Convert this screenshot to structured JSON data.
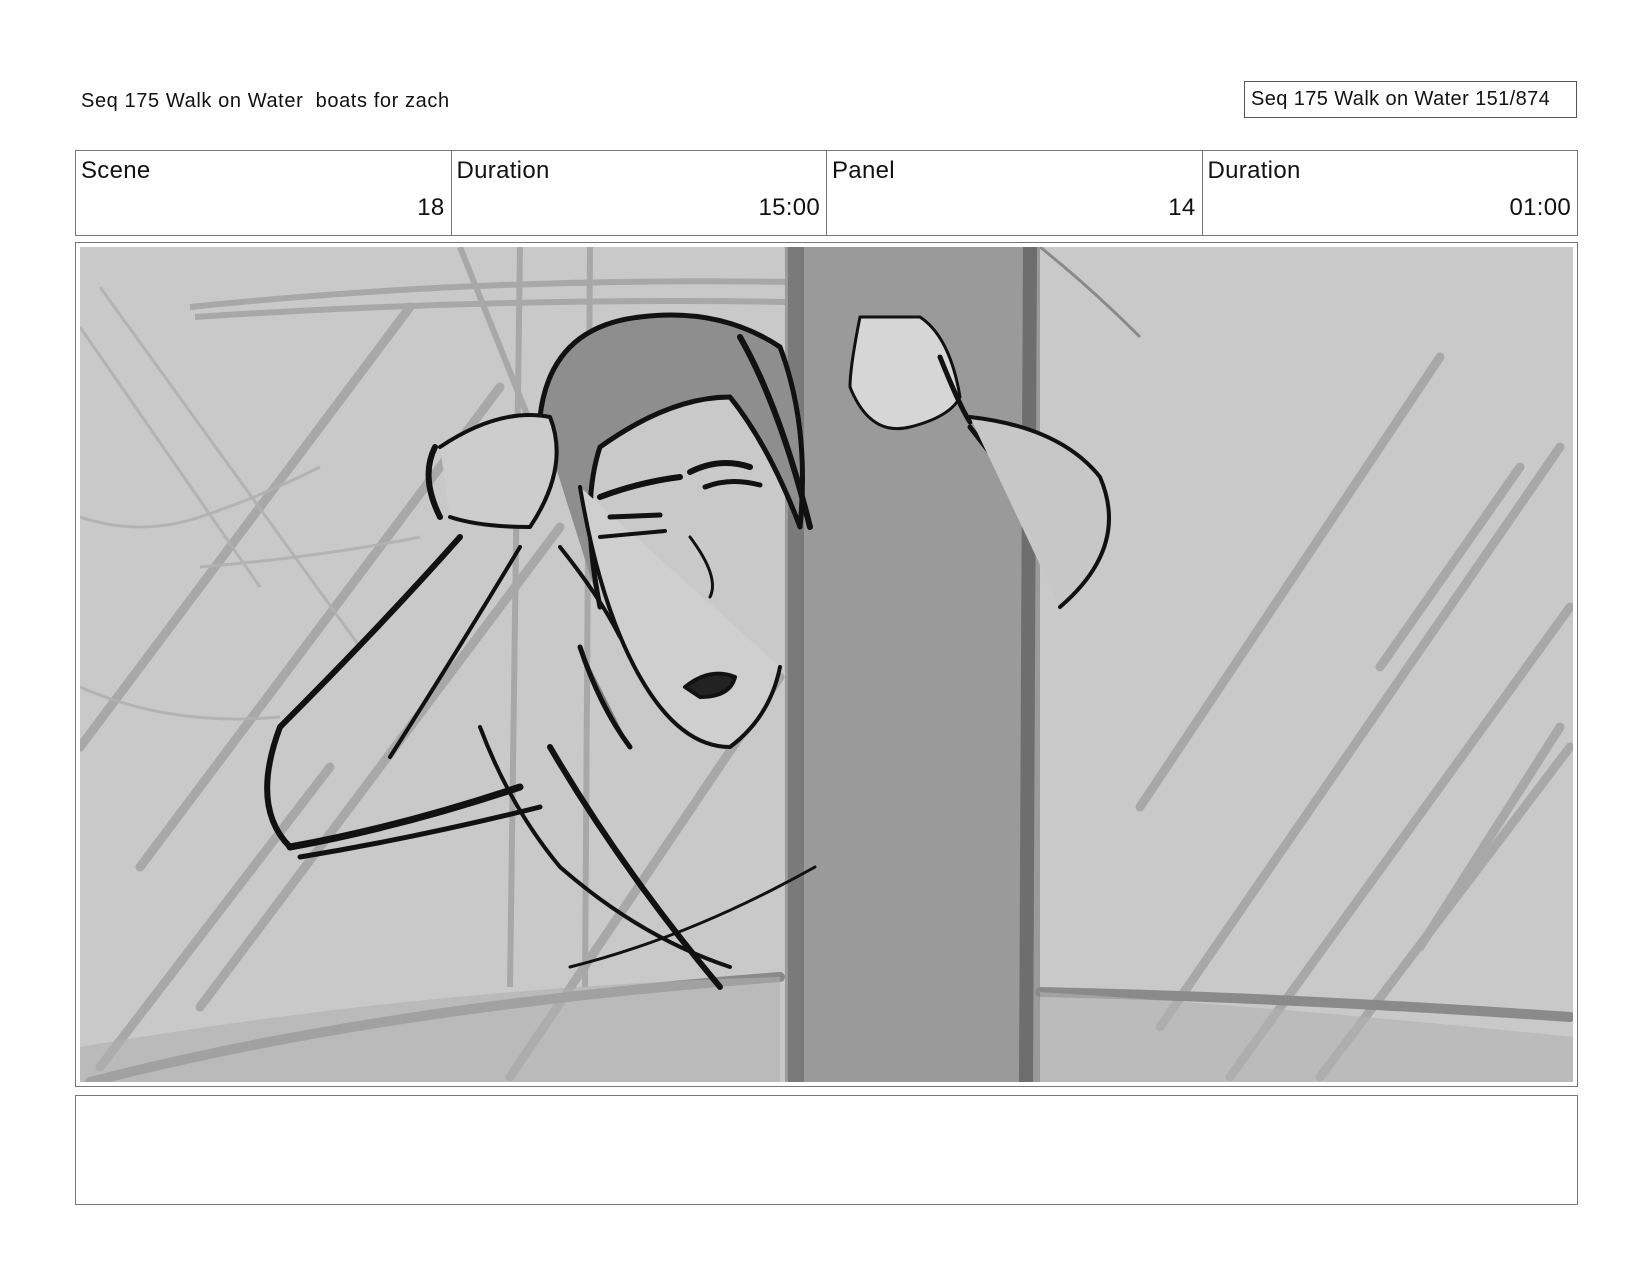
{
  "header": {
    "left_title": "Seq 175 Walk on Water  boats for zach",
    "right_title": "Seq 175 Walk on Water 151/874"
  },
  "info": [
    {
      "label": "Scene",
      "value": "18"
    },
    {
      "label": "Duration",
      "value": "15:00"
    },
    {
      "label": "Panel",
      "value": "14"
    },
    {
      "label": "Duration",
      "value": "01:00"
    }
  ],
  "panel": {
    "image_icon": "storyboard-sketch",
    "background_color": "#c9c9c9",
    "mast_color": "#9a9a9a"
  },
  "notes": {
    "text": ""
  }
}
